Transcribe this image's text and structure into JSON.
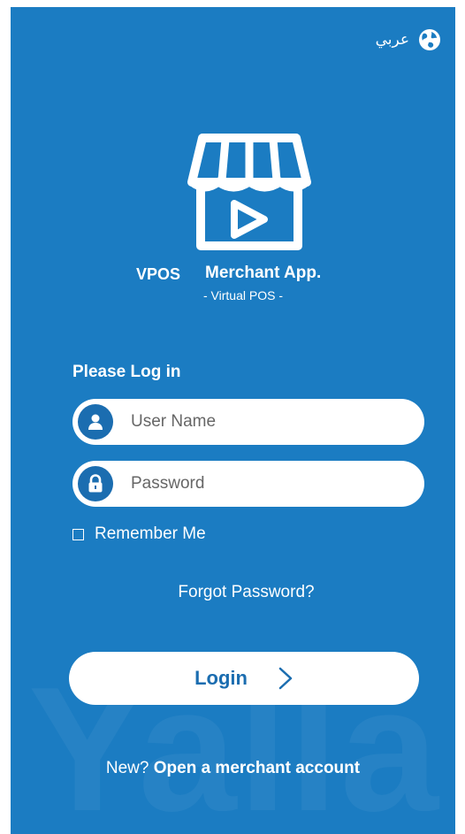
{
  "language": {
    "label": "عربي",
    "icon": "globe-icon"
  },
  "brand": {
    "logo_icon": "storefront-play-icon",
    "name_left": "VPOS",
    "name_right": "Merchant App.",
    "tagline": "- Virtual POS -"
  },
  "login": {
    "prompt": "Please Log in",
    "username": {
      "placeholder": "User Name",
      "value": "",
      "icon": "user-icon"
    },
    "password": {
      "placeholder": "Password",
      "value": "",
      "icon": "lock-icon"
    },
    "remember_label": "Remember Me",
    "forgot_label": "Forgot Password?",
    "button_label": "Login",
    "button_icon": "chevron-right-icon"
  },
  "signup": {
    "prefix": "New?",
    "link": "Open a merchant account"
  },
  "watermark": "Yalla",
  "colors": {
    "background": "#1b7cc2",
    "accent": "#1b6db0",
    "surface": "#ffffff"
  }
}
